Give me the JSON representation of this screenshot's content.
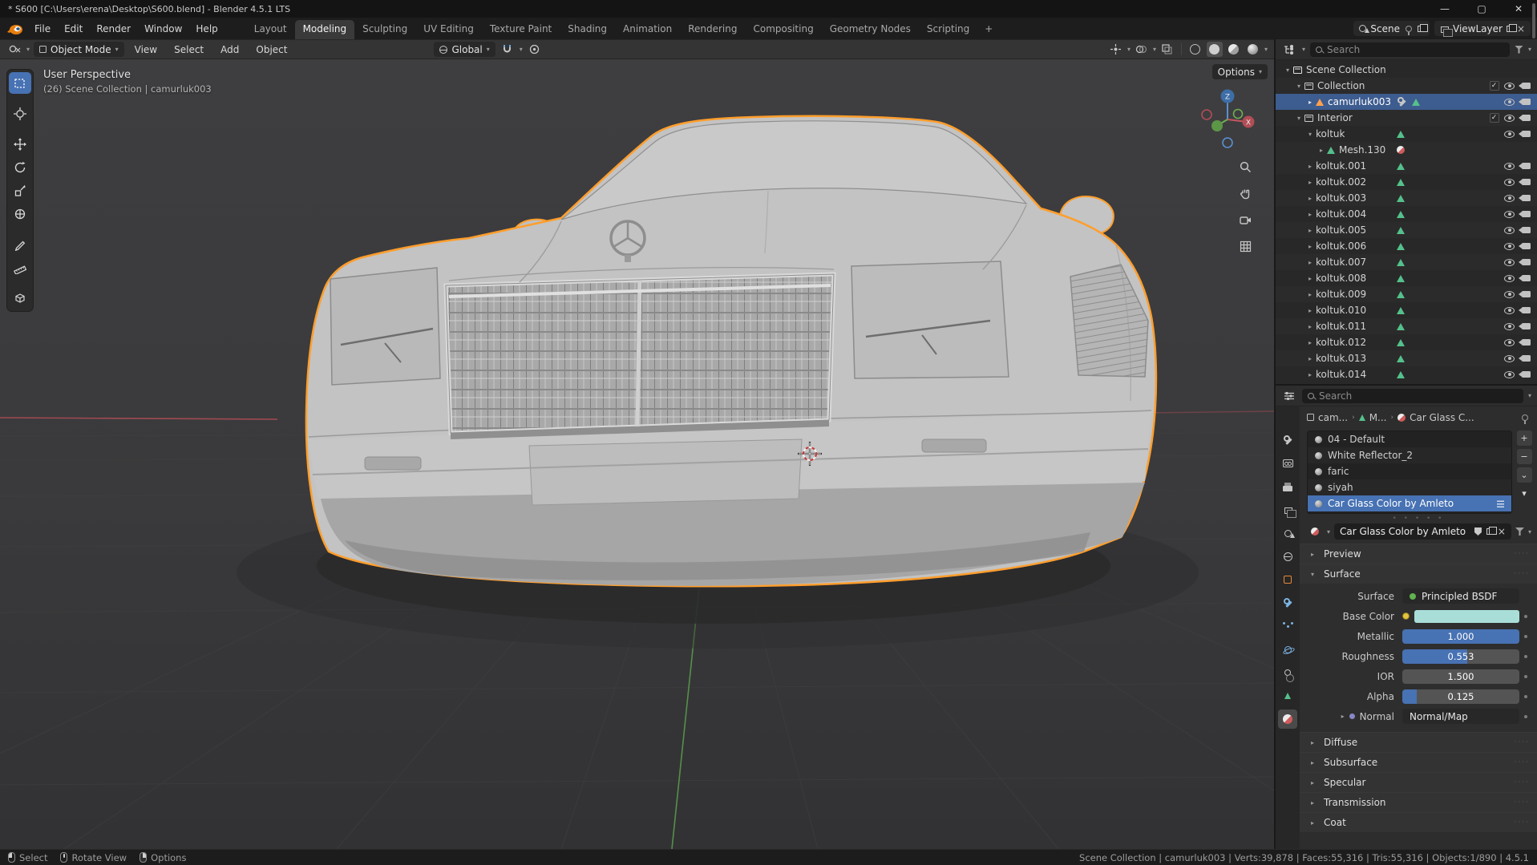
{
  "window": {
    "title": "* S600 [C:\\Users\\erena\\Desktop\\S600.blend] - Blender 4.5.1 LTS",
    "minimize": "—",
    "maximize": "▢",
    "close": "✕"
  },
  "topbar": {
    "menus": [
      {
        "label": "File"
      },
      {
        "label": "Edit"
      },
      {
        "label": "Render"
      },
      {
        "label": "Window"
      },
      {
        "label": "Help"
      }
    ],
    "workspaces": [
      {
        "label": "Layout"
      },
      {
        "label": "Modeling",
        "active": true
      },
      {
        "label": "Sculpting"
      },
      {
        "label": "UV Editing"
      },
      {
        "label": "Texture Paint"
      },
      {
        "label": "Shading"
      },
      {
        "label": "Animation"
      },
      {
        "label": "Rendering"
      },
      {
        "label": "Compositing"
      },
      {
        "label": "Geometry Nodes"
      },
      {
        "label": "Scripting"
      }
    ],
    "add_workspace": "+",
    "scene": "Scene",
    "viewlayer": "ViewLayer"
  },
  "toolheader": {
    "mode": "Object Mode",
    "menus": [
      {
        "label": "View"
      },
      {
        "label": "Select"
      },
      {
        "label": "Add"
      },
      {
        "label": "Object"
      }
    ],
    "orientation": "Global"
  },
  "viewport": {
    "view_label": "User Perspective",
    "context_label": "(26) Scene Collection | camurluk003",
    "options_label": "Options"
  },
  "outliner": {
    "search_placeholder": "Search",
    "scene_collection": "Scene Collection",
    "collection": "Collection",
    "active_object": "camurluk003",
    "interior": "Interior",
    "koltuk": "koltuk",
    "mesh": "Mesh.130",
    "koltuk_items": [
      "koltuk.001",
      "koltuk.002",
      "koltuk.003",
      "koltuk.004",
      "koltuk.005",
      "koltuk.006",
      "koltuk.007",
      "koltuk.008",
      "koltuk.009",
      "koltuk.010",
      "koltuk.011",
      "koltuk.012",
      "koltuk.013",
      "koltuk.014"
    ]
  },
  "properties": {
    "search_placeholder": "Search",
    "breadcrumb": {
      "object": "cam...",
      "data": "M...",
      "material": "Car Glass C..."
    },
    "slots": [
      {
        "name": "04 - Default"
      },
      {
        "name": "White Reflector_2"
      },
      {
        "name": "faric"
      },
      {
        "name": "siyah"
      },
      {
        "name": "Car Glass Color by Amleto",
        "selected": true
      }
    ],
    "list_buttons": {
      "add": "+",
      "remove": "−",
      "specials": "⌄",
      "down": "▾"
    },
    "material_name": "Car Glass Color by Amleto",
    "unlink": "×",
    "panels": {
      "preview": "Preview",
      "surface": "Surface"
    },
    "surface": {
      "surface_row": {
        "label": "Surface",
        "value": "Principled BSDF"
      },
      "base_color": {
        "label": "Base Color",
        "hex": "#a9ded8"
      },
      "metallic": {
        "label": "Metallic",
        "value": "1.000",
        "fill": 1
      },
      "roughness": {
        "label": "Roughness",
        "value": "0.553",
        "fill": 0.553
      },
      "ior": {
        "label": "IOR",
        "value": "1.500",
        "fill": 0
      },
      "alpha": {
        "label": "Alpha",
        "value": "0.125",
        "fill": 0.125
      },
      "normal": {
        "label": "Normal",
        "value": "Normal/Map"
      }
    },
    "collapsed_panels": [
      "Diffuse",
      "Subsurface",
      "Specular",
      "Transmission",
      "Coat"
    ],
    "tabs": [
      "tool",
      "render",
      "output",
      "view-layer",
      "scene",
      "world",
      "object",
      "modifiers",
      "particles",
      "physics",
      "constraints",
      "object-data",
      "material"
    ]
  },
  "statusbar": {
    "hints": [
      {
        "label": "Select"
      },
      {
        "label": "Rotate View"
      },
      {
        "label": "Options"
      }
    ],
    "info": "Scene Collection | camurluk003 | Verts:39,878 | Faces:55,316 | Tris:55,316 | Objects:1/890 | 4.5.1"
  },
  "colors": {
    "accent_blue": "#4772b3",
    "selection_outline": "#ff9e2c",
    "base_color_swatch": "#a9ded8"
  },
  "icons": {
    "search-icon": "magnifier (css circle+handle)",
    "filter-icon": "funnel (css clip-path)",
    "eye-icon": "ellipse+pupil",
    "camera-icon": "body+lens triangle",
    "mesh-data-icon": "green triangle",
    "object-icon": "orange triangle",
    "material-icon": "red/white sphere",
    "collection-icon": "crate box",
    "wrench-icon": "bar+ring"
  }
}
